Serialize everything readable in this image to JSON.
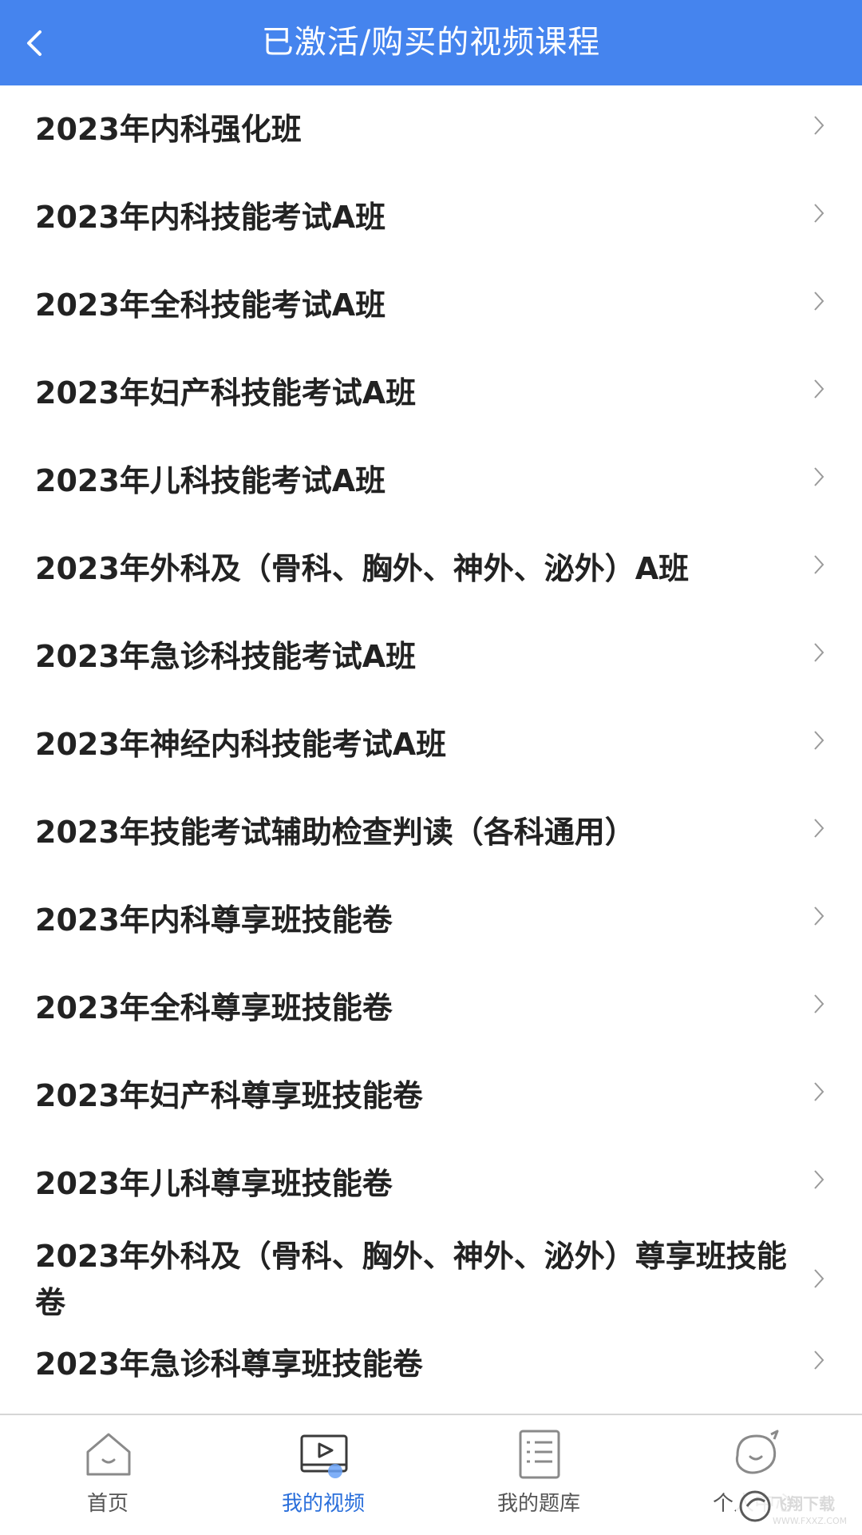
{
  "header": {
    "title": "已激活/购买的视频课程"
  },
  "courses": [
    "2023年内科强化班",
    "2023年内科技能考试A班",
    "2023年全科技能考试A班",
    "2023年妇产科技能考试A班",
    "2023年儿科技能考试A班",
    "2023年外科及（骨科、胸外、神外、泌外）A班",
    "2023年急诊科技能考试A班",
    "2023年神经内科技能考试A班",
    "2023年技能考试辅助检查判读（各科通用）",
    "2023年内科尊享班技能卷",
    "2023年全科尊享班技能卷",
    "2023年妇产科尊享班技能卷",
    "2023年儿科尊享班技能卷",
    "2023年外科及（骨科、胸外、神外、泌外）尊享班技能卷",
    "2023年急诊科尊享班技能卷"
  ],
  "tabs": [
    {
      "label": "首页",
      "icon": "home-icon",
      "active": false
    },
    {
      "label": "我的视频",
      "icon": "video-icon",
      "active": true
    },
    {
      "label": "我的题库",
      "icon": "question-bank-icon",
      "active": false
    },
    {
      "label": "个人中心",
      "icon": "profile-icon",
      "active": false
    }
  ],
  "watermark": {
    "text": "飞翔下载",
    "url": "WWW.FXXZ.COM"
  },
  "colors": {
    "nav": "#4584ee",
    "active_tab": "#2a6fdb",
    "inactive_tab": "#555555"
  }
}
